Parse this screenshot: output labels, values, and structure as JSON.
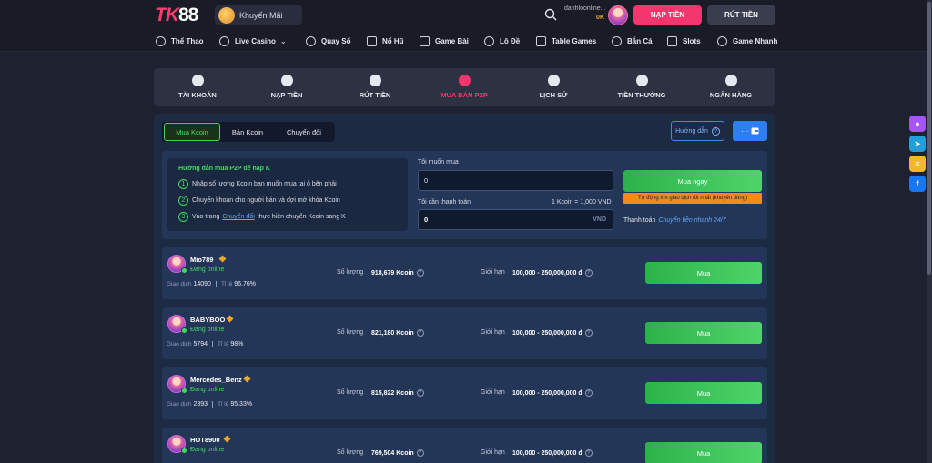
{
  "header": {
    "logo_text_1": "TK",
    "logo_text_2": "88",
    "promo_label": "Khuyến Mãi",
    "user_name": "danhloonline...",
    "user_balance": "0K",
    "deposit_button": "NẠP TIỀN",
    "withdraw_button": "RÚT TIỀN"
  },
  "nav": {
    "items": [
      {
        "label": "Thể Thao",
        "icon": "trophy-icon"
      },
      {
        "label": "Live Casino",
        "icon": "chip-icon"
      },
      {
        "label": "Quay Số",
        "icon": "lottery-ball-icon"
      },
      {
        "label": "Nổ Hũ",
        "icon": "jar-icon"
      },
      {
        "label": "Game Bài",
        "icon": "cards-icon"
      },
      {
        "label": "Lô Đề",
        "icon": "medal-icon"
      },
      {
        "label": "Table Games",
        "icon": "dice-icon"
      },
      {
        "label": "Bắn Cá",
        "icon": "fish-icon"
      },
      {
        "label": "Slots",
        "icon": "slot-machine-icon"
      },
      {
        "label": "Game Nhanh",
        "icon": "rocket-icon"
      }
    ]
  },
  "account_tabs": [
    {
      "label": "TÀI KHOẢN",
      "icon": "user-icon",
      "active": false
    },
    {
      "label": "NẠP TIỀN",
      "icon": "plus-circle-icon",
      "active": false
    },
    {
      "label": "RÚT TIỀN",
      "icon": "minus-circle-icon",
      "active": false
    },
    {
      "label": "MUA BÁN P2P",
      "icon": "p2p-icon",
      "active": true
    },
    {
      "label": "LỊCH SỬ",
      "icon": "clock-icon",
      "active": false
    },
    {
      "label": "TIỀN THƯỞNG",
      "icon": "gift-icon",
      "active": false
    },
    {
      "label": "NGÂN HÀNG",
      "icon": "bank-icon",
      "active": false
    }
  ],
  "sub_tabs": [
    {
      "label": "Mua Kcoin",
      "active": true
    },
    {
      "label": "Bán Kcoin",
      "active": false
    },
    {
      "label": "Chuyển đổi",
      "active": false
    }
  ],
  "guide_button": "Hướng dẫn",
  "wallet_button": "···",
  "guide": {
    "title": "Hướng dẫn mua P2P để nạp K",
    "step1": "Nhập số lượng Kcoin bạn muốn mua tại ô bên phải",
    "step2": "Chuyển khoản cho người bán và đợi mở khóa Kcoin",
    "step3_pre": "Vào trang",
    "step3_link": "Chuyển đổi",
    "step3_post": "thực hiện chuyển Kcoin sang K",
    "num1": "1",
    "num2": "2",
    "num3": "3"
  },
  "buy_form": {
    "want_label": "Tôi muốn mua",
    "want_value": "0",
    "pay_label": "Tôi cần thanh toán",
    "rate": "1 Kcoin = 1,000 VND",
    "pay_value": "0",
    "pay_suffix": "VND",
    "buy_now": "Mua ngay",
    "auto_note": "Tự động tìm giao dịch tốt nhất (khuyến dùng)",
    "pay_method_label": "Thanh toán",
    "pay_method_value": "Chuyển tiền nhanh 24/7"
  },
  "seller_labels": {
    "qty_label": "Số lượng",
    "limit_label": "Giới hạn",
    "trades_label": "Giao dịch",
    "rate_label": "Tỉ lệ",
    "buy_button": "Mua"
  },
  "sellers": [
    {
      "name": "Mio789",
      "status": "Đang online",
      "trades": "14090",
      "rate": "96.76%",
      "qty": "918,679 Kcoin",
      "limit": "100,000 - 250,000,000 đ"
    },
    {
      "name": "BABYBOO",
      "status": "Đang online",
      "trades": "5794",
      "rate": "98%",
      "qty": "821,180 Kcoin",
      "limit": "100,000 - 250,000,000 đ"
    },
    {
      "name": "Mercedes_Benz",
      "status": "Đang online",
      "trades": "2393",
      "rate": "95.33%",
      "qty": "815,822 Kcoin",
      "limit": "100,000 - 250,000,000 đ"
    },
    {
      "name": "HOT8900",
      "status": "Đang online",
      "trades": "",
      "rate": "",
      "qty": "769,504 Kcoin",
      "limit": "100,000 - 250,000,000 đ"
    }
  ],
  "colors": {
    "accent_pink": "#f3376c",
    "accent_green": "#3ddc5e",
    "link_blue": "#5ea8ff",
    "panel_bg": "#1c2a44"
  }
}
